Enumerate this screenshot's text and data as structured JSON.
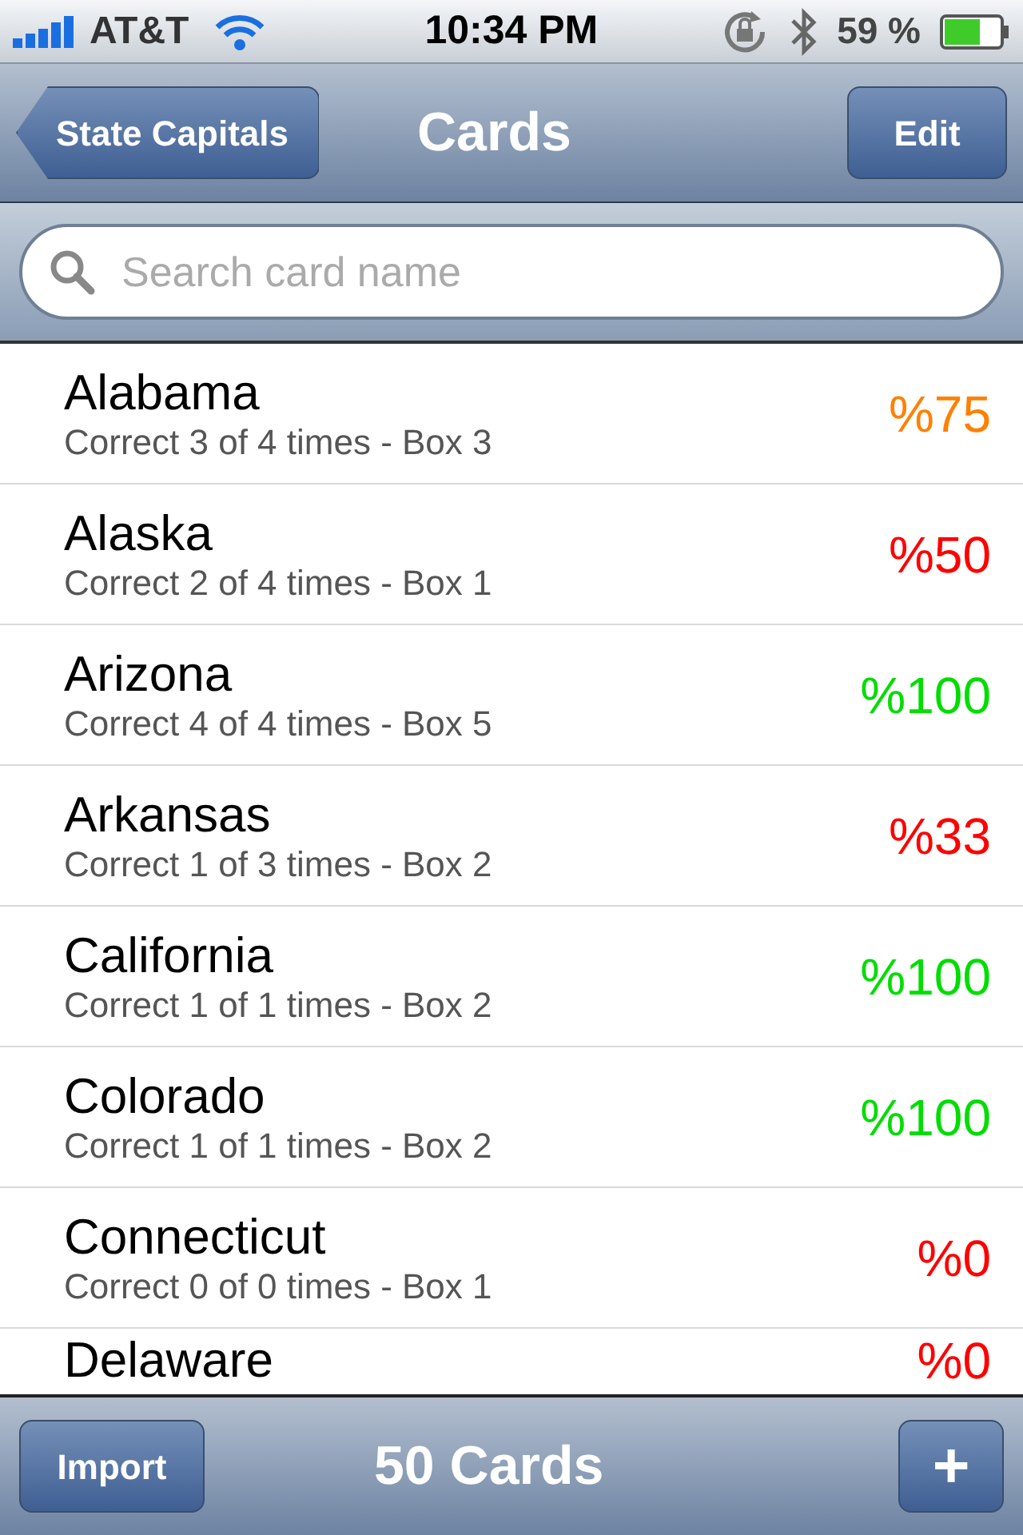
{
  "status_bar": {
    "carrier": "AT&T",
    "time": "10:34 PM",
    "battery": "59 %"
  },
  "nav_bar": {
    "back": "State Capitals",
    "title": "Cards",
    "edit": "Edit"
  },
  "search": {
    "placeholder": "Search card name"
  },
  "cards": [
    {
      "name": "Alabama",
      "detail": "Correct 3 of 4 times - Box 3",
      "score": "%75",
      "color": "#ff8000"
    },
    {
      "name": "Alaska",
      "detail": "Correct 2 of 4 times - Box 1",
      "score": "%50",
      "color": "#ff0000"
    },
    {
      "name": "Arizona",
      "detail": "Correct 4 of 4 times - Box 5",
      "score": "%100",
      "color": "#00dd00"
    },
    {
      "name": "Arkansas",
      "detail": "Correct 1 of 3 times - Box 2",
      "score": "%33",
      "color": "#ff0000"
    },
    {
      "name": "California",
      "detail": "Correct 1 of 1 times - Box 2",
      "score": "%100",
      "color": "#00dd00"
    },
    {
      "name": "Colorado",
      "detail": "Correct 1 of 1 times - Box 2",
      "score": "%100",
      "color": "#00dd00"
    },
    {
      "name": "Connecticut",
      "detail": "Correct 0 of 0 times - Box 1",
      "score": "%0",
      "color": "#ff0000"
    },
    {
      "name": "Delaware",
      "score": "%0",
      "color": "#ff0000"
    }
  ],
  "toolbar": {
    "import": "Import",
    "count": "50 Cards",
    "add": "+"
  }
}
